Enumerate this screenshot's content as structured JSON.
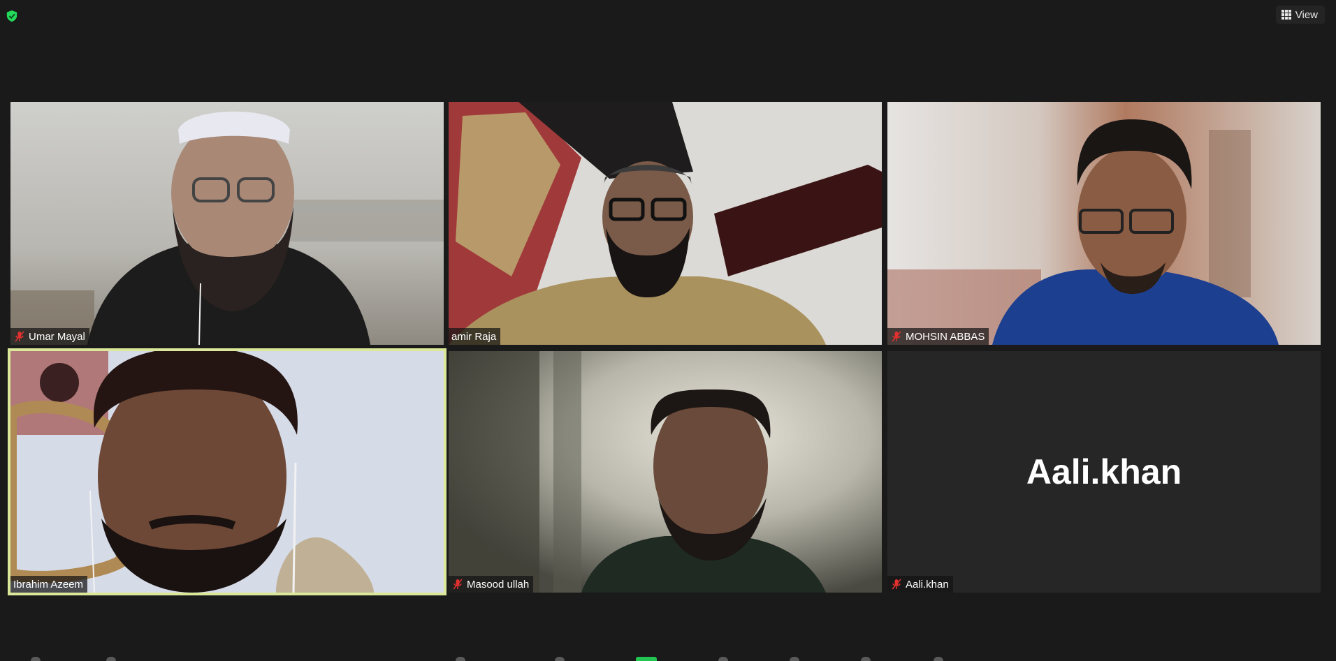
{
  "header": {
    "view_label": "View",
    "shield_icon": "encryption-shield-icon"
  },
  "participants": [
    {
      "name": "Umar Mayal",
      "muted": true,
      "video": "on"
    },
    {
      "name": "amir Raja",
      "muted": false,
      "video": "on"
    },
    {
      "name": "MOHSIN ABBAS",
      "muted": true,
      "video": "on"
    },
    {
      "name": "Ibrahim Azeem",
      "muted": false,
      "video": "on",
      "active_speaker": true
    },
    {
      "name": "Masood ullah",
      "muted": true,
      "video": "on"
    },
    {
      "name": "Aali.khan",
      "muted": true,
      "video": "off",
      "display_name": "Aali.khan"
    }
  ],
  "colors": {
    "background": "#1a1a1a",
    "active_speaker_border": "#dbe89a",
    "muted_icon": "#e0302f",
    "shield": "#23d959"
  }
}
